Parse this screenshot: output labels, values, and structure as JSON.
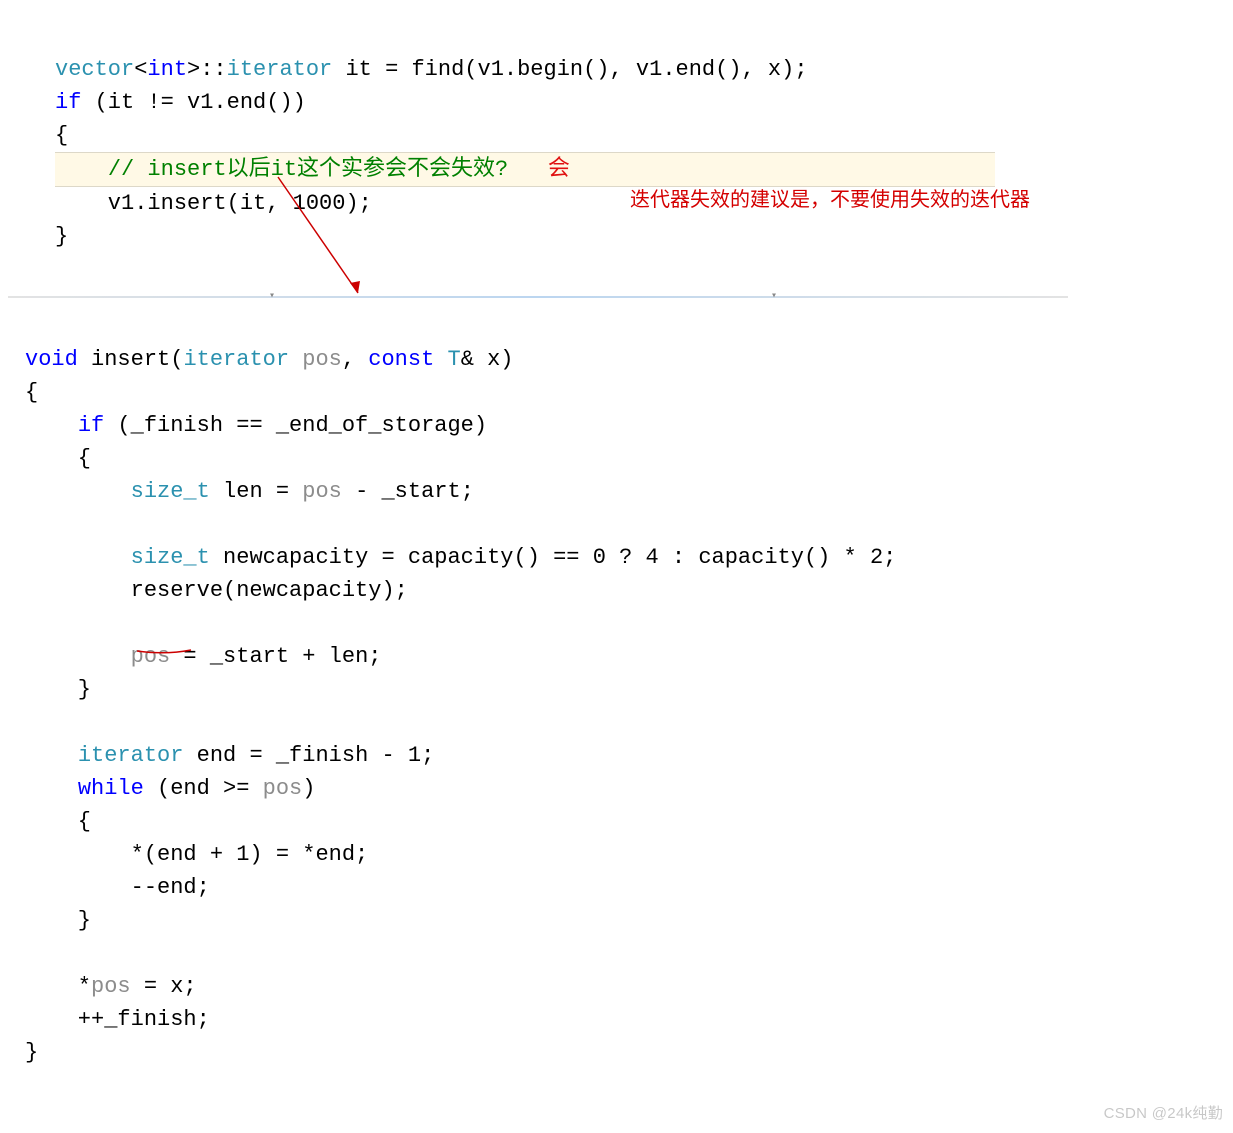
{
  "top": {
    "l1": {
      "a": "vector",
      "b": "<",
      "c": "int",
      "d": ">::",
      "e": "iterator",
      "f": " it = find(v1.begin(), v1.end(), x);"
    },
    "l2": {
      "a": "if",
      "b": " (it != v1.end())"
    },
    "l3": "{",
    "l4": {
      "indent": "    ",
      "comment": "// insert以后it这个实参会不会失效?",
      "gap": "   ",
      "ans": "会"
    },
    "l5": "    v1.insert(it, 1000);",
    "l6": "}"
  },
  "annotation": "迭代器失效的建议是，不要使用失效的迭代器",
  "bottom": {
    "l1": {
      "a": "void",
      "b": " insert(",
      "c": "iterator",
      "d": " ",
      "e": "pos",
      "f": ", ",
      "g": "const",
      "h": " ",
      "i": "T",
      "j": "& x)"
    },
    "l2": "{",
    "l3": {
      "a": "    ",
      "b": "if",
      "c": " (_finish == _end_of_storage)"
    },
    "l4": "    {",
    "l5": {
      "a": "        ",
      "b": "size_t",
      "c": " len = ",
      "d": "pos",
      "e": " - _start;"
    },
    "l6": "",
    "l7": {
      "a": "        ",
      "b": "size_t",
      "c": " newcapacity = capacity() == 0 ? 4 : capacity() * 2;"
    },
    "l8": "        reserve(newcapacity);",
    "l9": "",
    "l10": {
      "a": "        ",
      "b": "pos",
      "c": " = _start + len;"
    },
    "l11": "    }",
    "l12": "",
    "l13": {
      "a": "    ",
      "b": "iterator",
      "c": " end = _finish - 1;"
    },
    "l14": {
      "a": "    ",
      "b": "while",
      "c": " (end >= ",
      "d": "pos",
      "e": ")"
    },
    "l15": "    {",
    "l16": "        *(end + 1) = *end;",
    "l17": "        --end;",
    "l18": "    }",
    "l19": "",
    "l20": {
      "a": "    *",
      "b": "pos",
      "c": " = x;"
    },
    "l21": "    ++_finish;",
    "l22": "}"
  },
  "watermark": "CSDN @24k纯勤"
}
